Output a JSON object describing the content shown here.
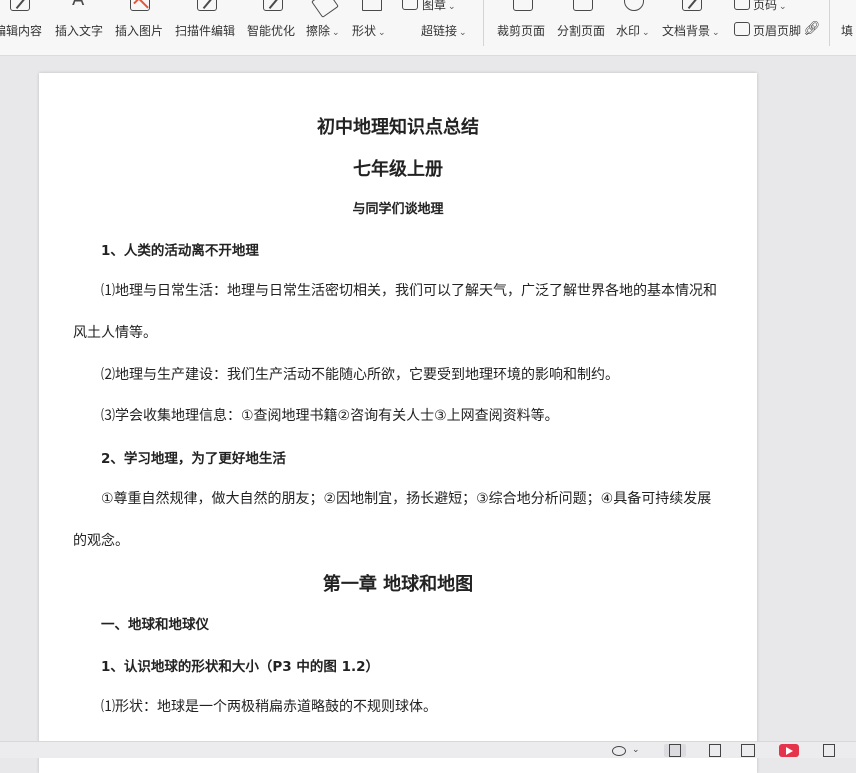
{
  "toolbar": {
    "edit_content": "编辑内容",
    "insert_text": "插入文字",
    "insert_image": "插入图片",
    "scan_edit": "扫描件编辑",
    "smart_optimize": "智能优化",
    "erase": "擦除",
    "shape": "形状",
    "image": "图章",
    "hyperlink": "超链接",
    "crop_page": "裁剪页面",
    "split_page": "分割页面",
    "watermark": "水印",
    "doc_background": "文档背景",
    "page_number": "页码",
    "header_footer": "页眉页脚",
    "fill": "填"
  },
  "document": {
    "title": "初中地理知识点总结",
    "grade": "七年级上册",
    "section": "与同学们谈地理",
    "h1": "1、人类的活动离不开地理",
    "p1a": "⑴地理与日常生活：地理与日常生活密切相关，我们可以了解天气，广泛了解世界各地的基本情况和",
    "p1b": "风土人情等。",
    "p2": "⑵地理与生产建设：我们生产活动不能随心所欲，它要受到地理环境的影响和制约。",
    "p3": "⑶学会收集地理信息：①查阅地理书籍②咨询有关人士③上网查阅资料等。",
    "h2": "2、学习地理，为了更好地生活",
    "p4a": "①尊重自然规律，做大自然的朋友；②因地制宜，扬长避短；③综合地分析问题；④具备可持续发展",
    "p4b": "的观念。",
    "chapter": "第一章 地球和地图",
    "h3": "一、地球和地球仪",
    "h4": "1、认识地球的形状和大小（P3 中的图 1.2）",
    "p5": "⑴形状：地球是一个两极稍扁赤道略鼓的不规则球体。"
  }
}
